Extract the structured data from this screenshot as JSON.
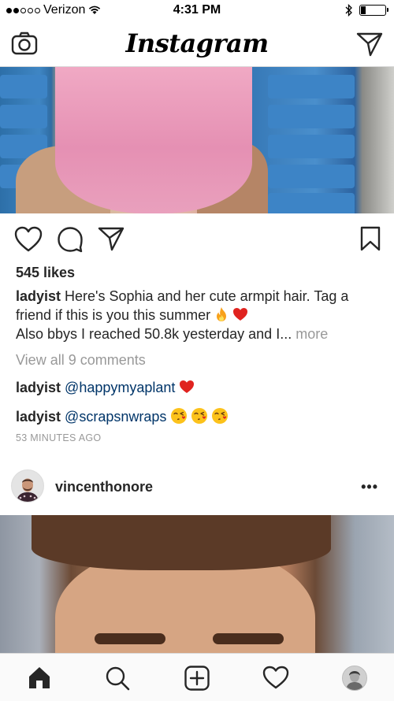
{
  "status_bar": {
    "carrier": "Verizon",
    "time": "4:31 PM",
    "signal_bars_filled": 2,
    "signal_bars_total": 5,
    "battery_level": 0.2
  },
  "nav": {
    "title": "Instagram",
    "camera_icon": "camera-icon",
    "direct_icon": "paper-plane-icon"
  },
  "post1": {
    "likes": "545 likes",
    "caption_user": "ladyist",
    "caption_text_1": "Here's Sophia and her cute armpit hair. Tag a friend if this is you this summer",
    "caption_text_2": "Also bbys I reached 50.8k yesterday and I...",
    "caption_more": "more",
    "view_comments": "View all 9 comments",
    "comments": [
      {
        "user": "ladyist",
        "mention": "@happymyaplant"
      },
      {
        "user": "ladyist",
        "mention": "@scrapsnwraps"
      }
    ],
    "timestamp": "53 MINUTES AGO"
  },
  "post2": {
    "username": "vincenthonore",
    "options": "•••"
  },
  "tabbar": {
    "items": [
      "home-icon",
      "search-icon",
      "new-post-icon",
      "activity-heart-icon",
      "profile-avatar"
    ]
  },
  "colors": {
    "mention": "#003569",
    "muted": "#999999",
    "text": "#262626",
    "border": "#dbdbdb"
  }
}
